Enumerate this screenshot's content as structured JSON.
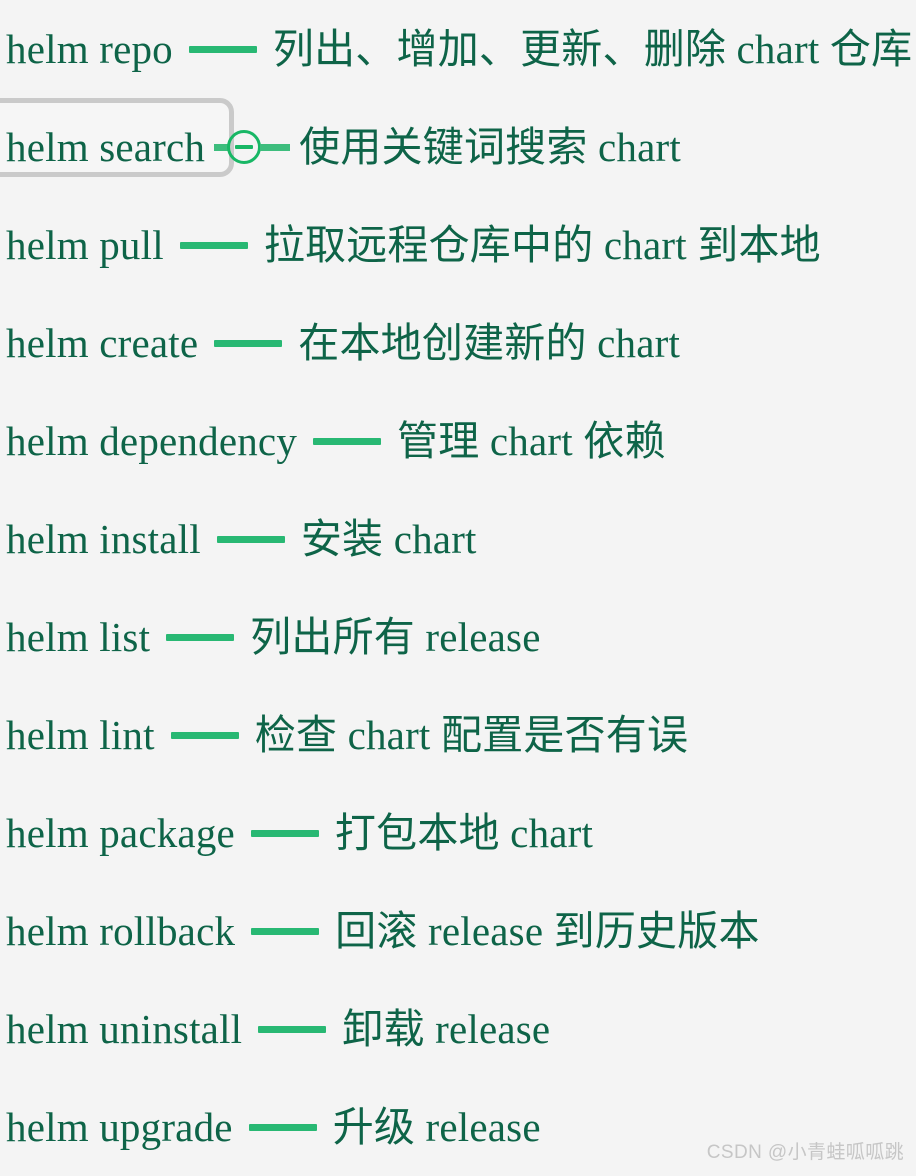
{
  "page": {
    "background_color": "#f4f4f4",
    "text_color": "#0e6448",
    "accent_color": "#28b873",
    "highlight_border_color": "#cacaca",
    "watermark_color": "#c6c6c6"
  },
  "watermark": {
    "text": "CSDN @小青蛙呱呱跳"
  },
  "rows": [
    {
      "command": "helm repo",
      "connector": "dash",
      "description": "列出、增加、更新、删除 chart 仓库",
      "highlighted": false
    },
    {
      "command": "helm search",
      "connector": "circle-minus",
      "description": "使用关键词搜索 chart",
      "highlighted": true
    },
    {
      "command": "helm pull",
      "connector": "dash",
      "description": "拉取远程仓库中的 chart 到本地",
      "highlighted": false
    },
    {
      "command": "helm create",
      "connector": "dash",
      "description": "在本地创建新的 chart",
      "highlighted": false
    },
    {
      "command": "helm dependency",
      "connector": "dash",
      "description": "管理 chart 依赖",
      "highlighted": false
    },
    {
      "command": "helm install",
      "connector": "dash",
      "description": "安装 chart",
      "highlighted": false
    },
    {
      "command": "helm list",
      "connector": "dash",
      "description": "列出所有 release",
      "highlighted": false
    },
    {
      "command": "helm lint",
      "connector": "dash",
      "description": "检查 chart 配置是否有误",
      "highlighted": false
    },
    {
      "command": "helm package",
      "connector": "dash",
      "description": "打包本地 chart",
      "highlighted": false
    },
    {
      "command": "helm rollback",
      "connector": "dash",
      "description": "回滚 release 到历史版本",
      "highlighted": false
    },
    {
      "command": "helm uninstall",
      "connector": "dash",
      "description": "卸载 release",
      "highlighted": false
    },
    {
      "command": "helm upgrade",
      "connector": "dash",
      "description": "升级 release",
      "highlighted": false
    }
  ]
}
